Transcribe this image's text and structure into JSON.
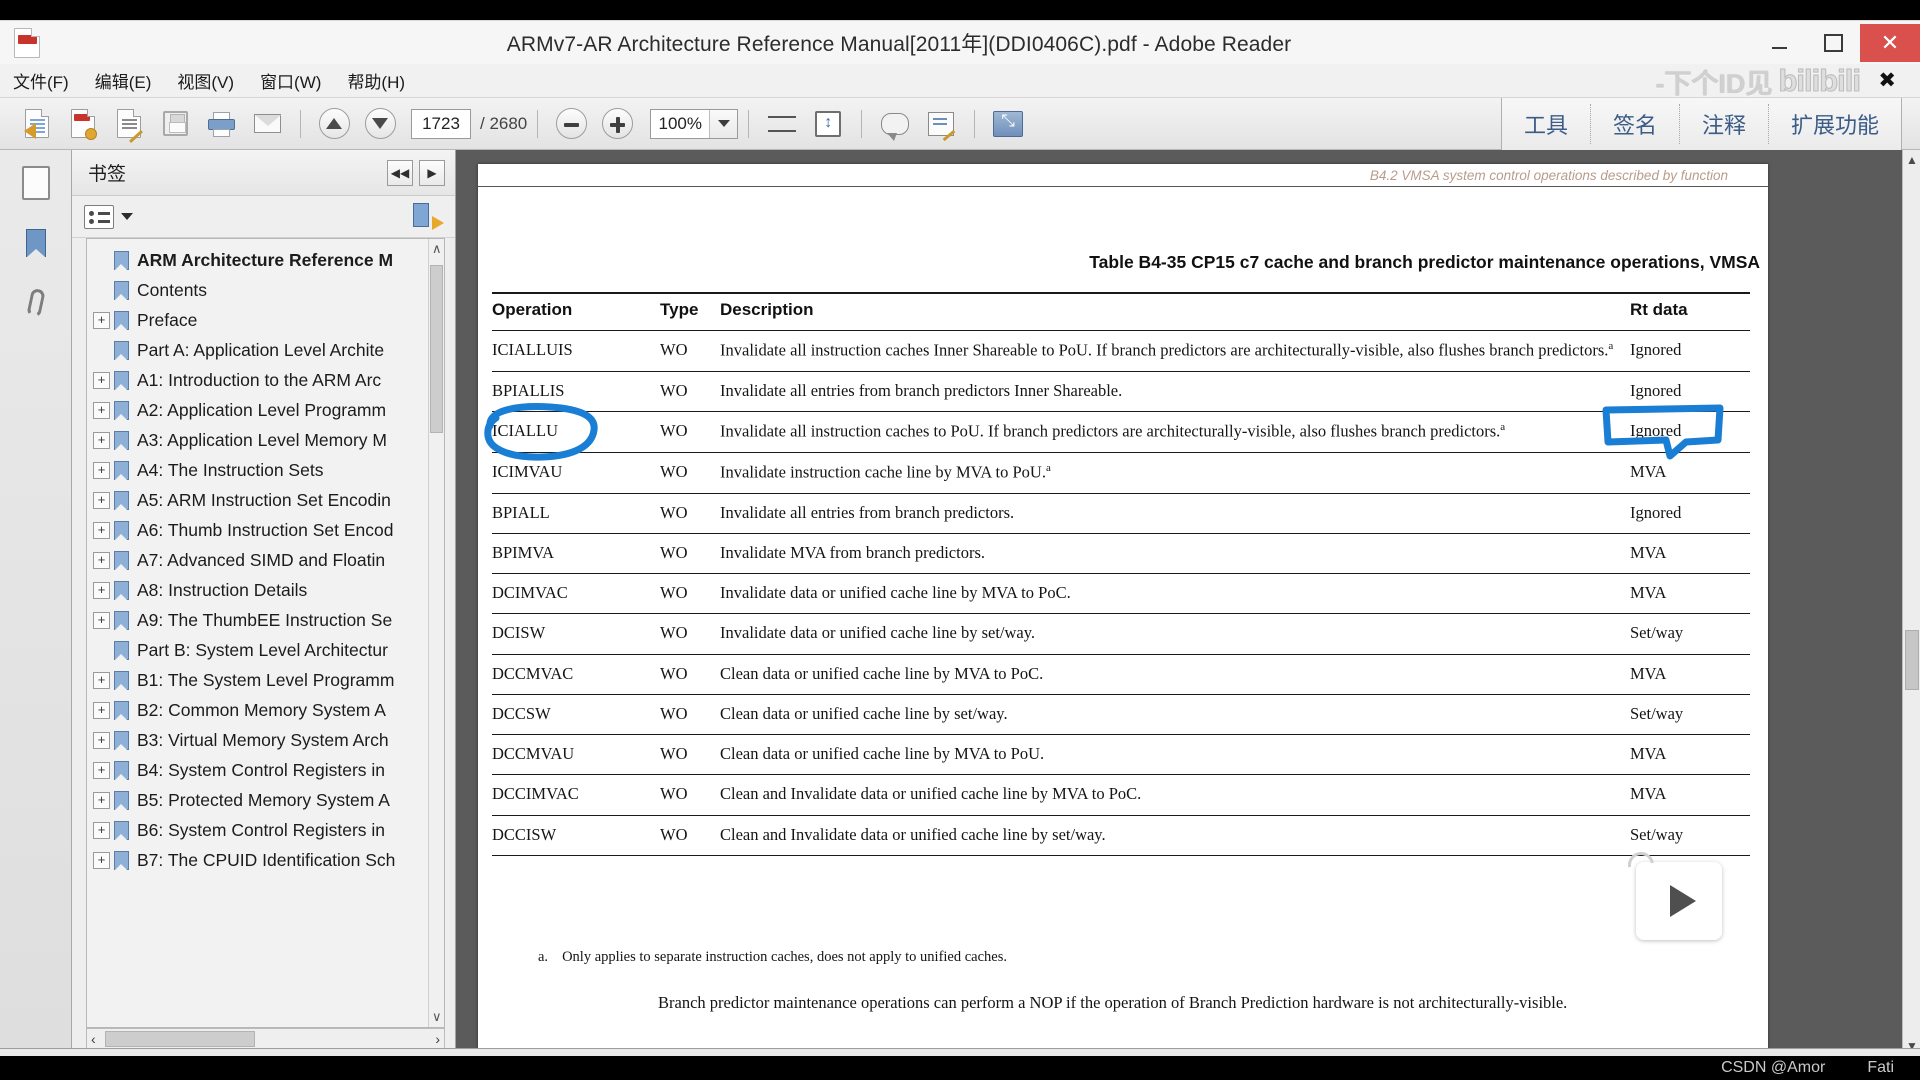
{
  "window": {
    "title": "ARMv7-AR Architecture Reference Manual[2011年](DDI0406C).pdf - Adobe Reader",
    "minimize_label": "",
    "maximize_label": "",
    "close_label": "✕"
  },
  "menubar": {
    "items": [
      {
        "label": "文件(F)",
        "name": "menu-file"
      },
      {
        "label": "编辑(E)",
        "name": "menu-edit"
      },
      {
        "label": "视图(V)",
        "name": "menu-view"
      },
      {
        "label": "窗口(W)",
        "name": "menu-window"
      },
      {
        "label": "帮助(H)",
        "name": "menu-help"
      }
    ],
    "watermark": "-下个ID见",
    "watermark_logo": "bilibili",
    "watermark_close": "✖"
  },
  "toolbar": {
    "page_current": "1723",
    "page_total": "/ 2680",
    "zoom_value": "100%",
    "right_tabs": [
      {
        "label": "工具",
        "name": "tool-tab-tools"
      },
      {
        "label": "签名",
        "name": "tool-tab-sign"
      },
      {
        "label": "注释",
        "name": "tool-tab-comment"
      },
      {
        "label": "扩展功能",
        "name": "tool-tab-extended"
      }
    ]
  },
  "bookmarks_panel": {
    "title": "书签",
    "collapse_label": "◀◀",
    "expand_label": "▶",
    "hscroll_left": "‹",
    "hscroll_right": "›",
    "vscroll_up": "∧",
    "vscroll_down": "∨",
    "items": [
      {
        "label": "ARM Architecture Reference M",
        "expandable": false,
        "bold": true
      },
      {
        "label": "Contents",
        "expandable": false,
        "bold": false
      },
      {
        "label": "Preface",
        "expandable": true,
        "bold": false
      },
      {
        "label": "Part A: Application Level Archite",
        "expandable": false,
        "bold": false
      },
      {
        "label": "A1: Introduction to the ARM Arc",
        "expandable": true,
        "bold": false
      },
      {
        "label": "A2: Application Level Programm",
        "expandable": true,
        "bold": false
      },
      {
        "label": "A3: Application Level Memory M",
        "expandable": true,
        "bold": false
      },
      {
        "label": "A4: The Instruction Sets",
        "expandable": true,
        "bold": false
      },
      {
        "label": "A5: ARM Instruction Set Encodin",
        "expandable": true,
        "bold": false
      },
      {
        "label": "A6: Thumb Instruction Set Encod",
        "expandable": true,
        "bold": false
      },
      {
        "label": "A7: Advanced SIMD and Floatin",
        "expandable": true,
        "bold": false
      },
      {
        "label": "A8: Instruction Details",
        "expandable": true,
        "bold": false
      },
      {
        "label": "A9: The ThumbEE Instruction Se",
        "expandable": true,
        "bold": false
      },
      {
        "label": "Part B: System Level Architectur",
        "expandable": false,
        "bold": false
      },
      {
        "label": "B1: The System Level Programm",
        "expandable": true,
        "bold": false
      },
      {
        "label": "B2: Common Memory System A",
        "expandable": true,
        "bold": false
      },
      {
        "label": "B3: Virtual Memory System Arch",
        "expandable": true,
        "bold": false
      },
      {
        "label": "B4: System Control Registers in",
        "expandable": true,
        "bold": false
      },
      {
        "label": "B5: Protected Memory System A",
        "expandable": true,
        "bold": false
      },
      {
        "label": "B6: System Control Registers in",
        "expandable": true,
        "bold": false
      },
      {
        "label": "B7: The CPUID Identification Sch",
        "expandable": true,
        "bold": false
      }
    ]
  },
  "document": {
    "running_header": "B4.2 VMSA system control operations described by function",
    "table_title": "Table B4-35 CP15 c7 cache and branch predictor maintenance operations, VMSA",
    "columns": [
      "Operation",
      "Type",
      "Description",
      "Rt data"
    ],
    "rows": [
      {
        "operation": "ICIALLUIS",
        "type": "WO",
        "description": "Invalidate all instruction caches Inner Shareable to PoU. If branch predictors are architecturally-visible, also flushes branch predictors.",
        "footnote": "a",
        "rt": "Ignored"
      },
      {
        "operation": "BPIALLIS",
        "type": "WO",
        "description": "Invalidate all entries from branch predictors Inner Shareable.",
        "footnote": "",
        "rt": "Ignored"
      },
      {
        "operation": "ICIALLU",
        "type": "WO",
        "description": "Invalidate all instruction caches to PoU. If branch predictors are architecturally-visible, also flushes branch predictors.",
        "footnote": "a",
        "rt": "Ignored"
      },
      {
        "operation": "ICIMVAU",
        "type": "WO",
        "description": "Invalidate instruction cache line by MVA to PoU.",
        "footnote": "a",
        "rt": "MVA"
      },
      {
        "operation": "BPIALL",
        "type": "WO",
        "description": "Invalidate all entries from branch predictors.",
        "footnote": "",
        "rt": "Ignored"
      },
      {
        "operation": "BPIMVA",
        "type": "WO",
        "description": "Invalidate MVA from branch predictors.",
        "footnote": "",
        "rt": "MVA"
      },
      {
        "operation": "DCIMVAC",
        "type": "WO",
        "description": "Invalidate data or unified cache line by MVA to PoC.",
        "footnote": "",
        "rt": "MVA"
      },
      {
        "operation": "DCISW",
        "type": "WO",
        "description": "Invalidate data or unified cache line by set/way.",
        "footnote": "",
        "rt": "Set/way"
      },
      {
        "operation": "DCCMVAC",
        "type": "WO",
        "description": "Clean data or unified cache line by MVA to PoC.",
        "footnote": "",
        "rt": "MVA"
      },
      {
        "operation": "DCCSW",
        "type": "WO",
        "description": "Clean data or unified cache line by set/way.",
        "footnote": "",
        "rt": "Set/way"
      },
      {
        "operation": "DCCMVAU",
        "type": "WO",
        "description": "Clean data or unified cache line by MVA to PoU.",
        "footnote": "",
        "rt": "MVA"
      },
      {
        "operation": "DCCIMVAC",
        "type": "WO",
        "description": "Clean and Invalidate data or unified cache line by MVA to PoC.",
        "footnote": "",
        "rt": "MVA"
      },
      {
        "operation": "DCCISW",
        "type": "WO",
        "description": "Clean and Invalidate data or unified cache line by set/way.",
        "footnote": "",
        "rt": "Set/way"
      }
    ],
    "footnote_marker": "a.",
    "footnote_text": "Only applies to separate instruction caches, does not apply to unified caches.",
    "paragraph": "Branch predictor maintenance operations can perform a NOP if the operation of Branch Prediction hardware is not architecturally-visible.",
    "annotation_color": "#1a7fd4"
  },
  "status": {
    "watermark_author": "CSDN @Amor",
    "watermark_suffix": "Fati"
  }
}
